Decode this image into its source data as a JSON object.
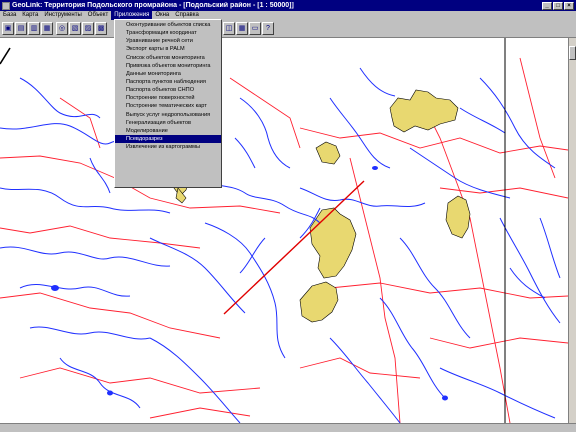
{
  "window": {
    "title": "GeoLink: Территория Подольского промрайона - [Подольский район - [1 : 50000]]",
    "controls": [
      "_",
      "□",
      "×"
    ]
  },
  "menubar": {
    "items": [
      {
        "label": "База"
      },
      {
        "label": "Карта"
      },
      {
        "label": "Инструменты"
      },
      {
        "label": "Объект"
      },
      {
        "label": "Приложения",
        "active": true
      },
      {
        "label": "Окна"
      },
      {
        "label": "Справка"
      }
    ]
  },
  "toolbar": {
    "buttons": [
      "save-icon",
      "open-icon",
      "copy-icon",
      "paste-icon",
      "search-icon",
      "map-icon",
      "layers-icon",
      "image-icon",
      "zoom-icon",
      "table-icon",
      "chart-icon",
      "grid-icon",
      "print-icon",
      "help-icon"
    ]
  },
  "dropdown": {
    "items": [
      {
        "label": "Оконтуривание объектов списка"
      },
      {
        "label": "Трансформация координат"
      },
      {
        "label": "Уравнивание речной сети"
      },
      {
        "label": "Экспорт карты в PALM"
      },
      {
        "label": "Список объектов мониторинга"
      },
      {
        "label": "Привязка объектов мониторинга"
      },
      {
        "label": "Данные мониторинга"
      },
      {
        "label": "Паспорта пунктов наблюдения"
      },
      {
        "label": "Паспорта объектов СНПО"
      },
      {
        "label": "Построение поверхностей"
      },
      {
        "label": "Построение тематических карт"
      },
      {
        "label": "Выпуск услуг недропользования"
      },
      {
        "label": "Генерализация объектов"
      },
      {
        "label": "Моделирование"
      },
      {
        "label": "Псевдоразрез",
        "highlighted": true
      },
      {
        "label": "Извлечение из картограммы"
      }
    ]
  },
  "colors": {
    "rivers": "#2030ff",
    "roads": "#ff2030",
    "settlements": "#e8d870",
    "profile_line": "#e00000",
    "highlight": "#000080"
  }
}
